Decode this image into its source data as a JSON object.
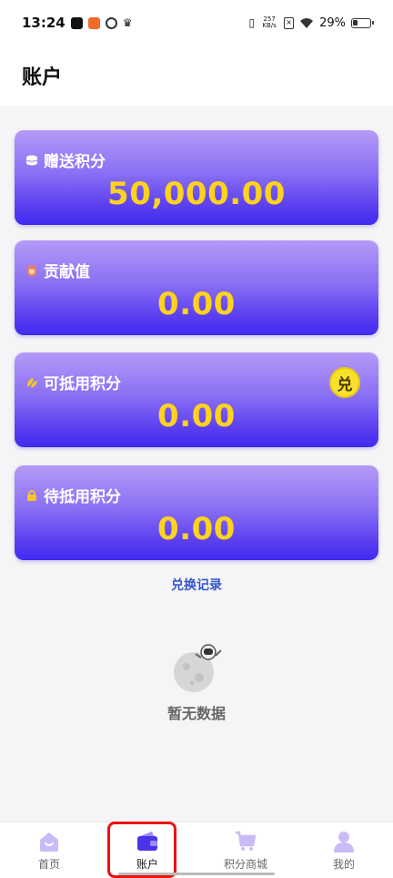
{
  "status_bar": {
    "time": "13:24",
    "net_speed_value": "257",
    "net_speed_unit": "KB/s",
    "battery": "29%"
  },
  "header": {
    "title": "账户"
  },
  "cards": [
    {
      "label": "赠送积分",
      "value": "50,000.00",
      "icon": "coins-icon"
    },
    {
      "label": "贡献值",
      "value": "0.00",
      "icon": "medal-icon"
    },
    {
      "label": "可抵用积分",
      "value": "0.00",
      "icon": "leaf-icon",
      "badge": "兑"
    },
    {
      "label": "待抵用积分",
      "value": "0.00",
      "icon": "lock-icon"
    }
  ],
  "exchange_record_label": "兑换记录",
  "empty_state": {
    "text": "暂无数据"
  },
  "bottom_nav": {
    "items": [
      {
        "label": "首页",
        "icon": "home-icon"
      },
      {
        "label": "账户",
        "icon": "wallet-icon"
      },
      {
        "label": "积分商城",
        "icon": "cart-icon"
      },
      {
        "label": "我的",
        "icon": "user-icon"
      }
    ],
    "active_index": 1
  },
  "colors": {
    "card_top": "#b59af7",
    "card_bottom": "#3f2bf0",
    "value": "#ffd21e",
    "link": "#3355cc",
    "highlight": "#ee1111"
  }
}
